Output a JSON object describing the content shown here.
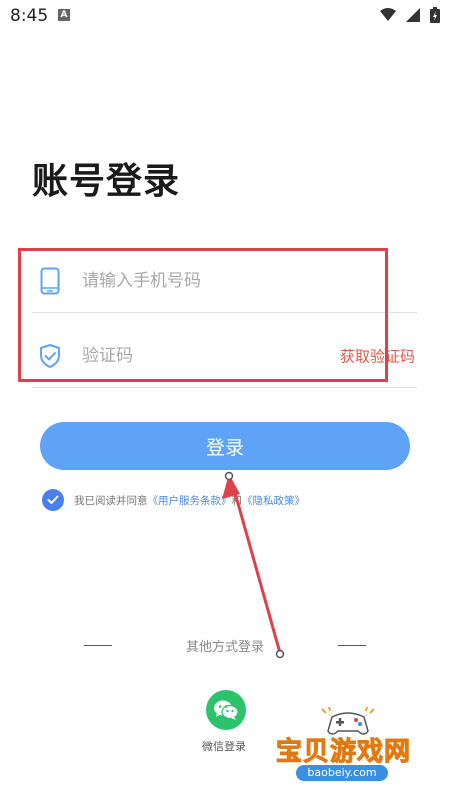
{
  "status_bar": {
    "time": "8:45",
    "app_icon_letter": "A",
    "icons": [
      "wifi-icon",
      "signal-icon",
      "battery-icon"
    ]
  },
  "page": {
    "title": "账号登录"
  },
  "form": {
    "phone_placeholder": "请输入手机号码",
    "code_placeholder": "验证码",
    "get_code_label": "获取验证码",
    "login_button": "登录"
  },
  "agreement": {
    "prefix": "我已阅读并同意",
    "terms_link": "《用户服务条款》",
    "connector": "和",
    "privacy_link": "《隐私政策》",
    "checked": true
  },
  "other_login": {
    "label": "其他方式登录",
    "wechat_label": "微信登录"
  },
  "watermark": {
    "title": "宝贝游戏网",
    "domain": "baobeiy.com"
  },
  "colors": {
    "accent_blue": "#5ea3f5",
    "checkbox_blue": "#4a7ff0",
    "link_blue": "#4a8bdc",
    "get_code_red": "#e05a4a",
    "annotation_red": "#e0404a",
    "wechat_green": "#2bc46b",
    "watermark_orange": "#f2a521"
  }
}
